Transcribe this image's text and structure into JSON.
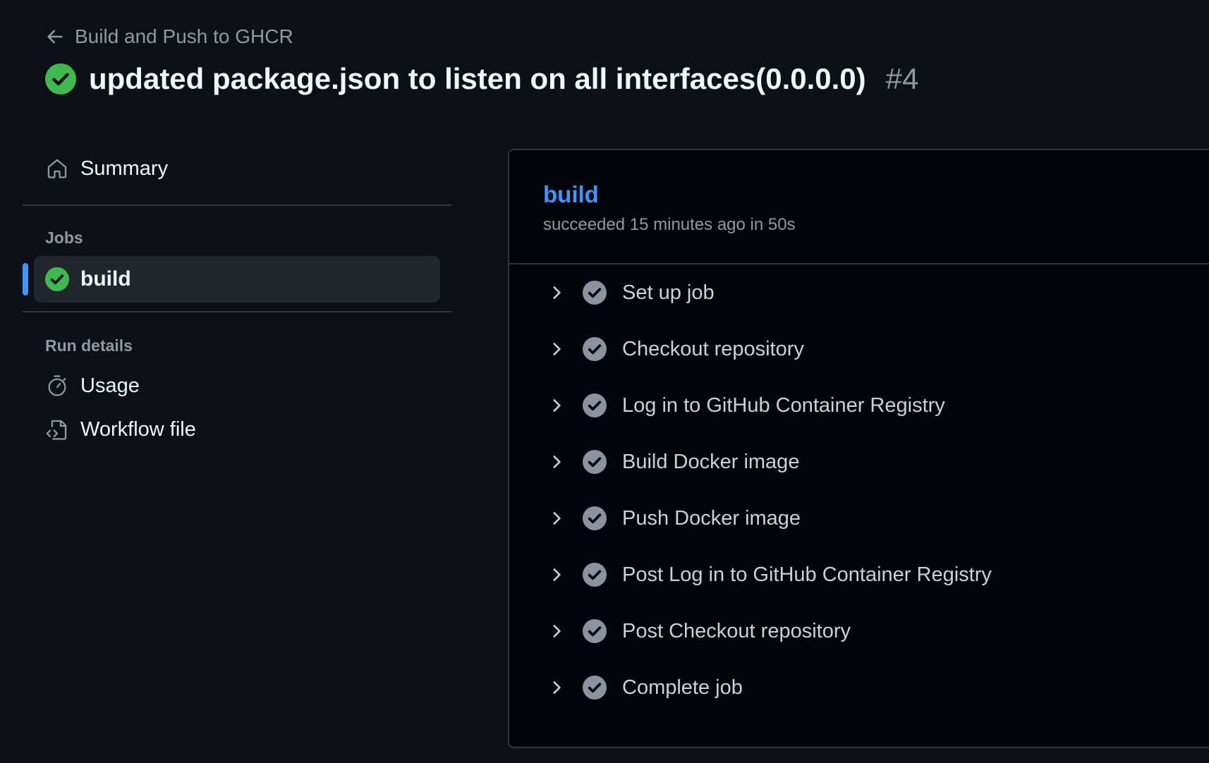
{
  "header": {
    "back_label": "Build and Push to GHCR",
    "run_title": "updated package.json to listen on all interfaces(0.0.0.0)",
    "run_number": "#4",
    "status": "success"
  },
  "sidebar": {
    "summary_label": "Summary",
    "jobs_heading": "Jobs",
    "jobs": [
      {
        "label": "build",
        "status": "success",
        "active": true
      }
    ],
    "run_details_heading": "Run details",
    "details": [
      {
        "label": "Usage",
        "icon": "stopwatch-icon"
      },
      {
        "label": "Workflow file",
        "icon": "file-code-icon"
      }
    ]
  },
  "job_panel": {
    "name": "build",
    "meta": "succeeded 15 minutes ago in 50s",
    "steps": [
      {
        "label": "Set up job",
        "status": "success"
      },
      {
        "label": "Checkout repository",
        "status": "success"
      },
      {
        "label": "Log in to GitHub Container Registry",
        "status": "success"
      },
      {
        "label": "Build Docker image",
        "status": "success"
      },
      {
        "label": "Push Docker image",
        "status": "success"
      },
      {
        "label": "Post Log in to GitHub Container Registry",
        "status": "success"
      },
      {
        "label": "Post Checkout repository",
        "status": "success"
      },
      {
        "label": "Complete job",
        "status": "success"
      }
    ]
  },
  "colors": {
    "background": "#0d1117",
    "panel_background": "#010409",
    "success_green": "#3fb950",
    "accent_blue": "#4493f8",
    "muted_text": "#9198a1",
    "step_check_gray": "#8b949e"
  }
}
